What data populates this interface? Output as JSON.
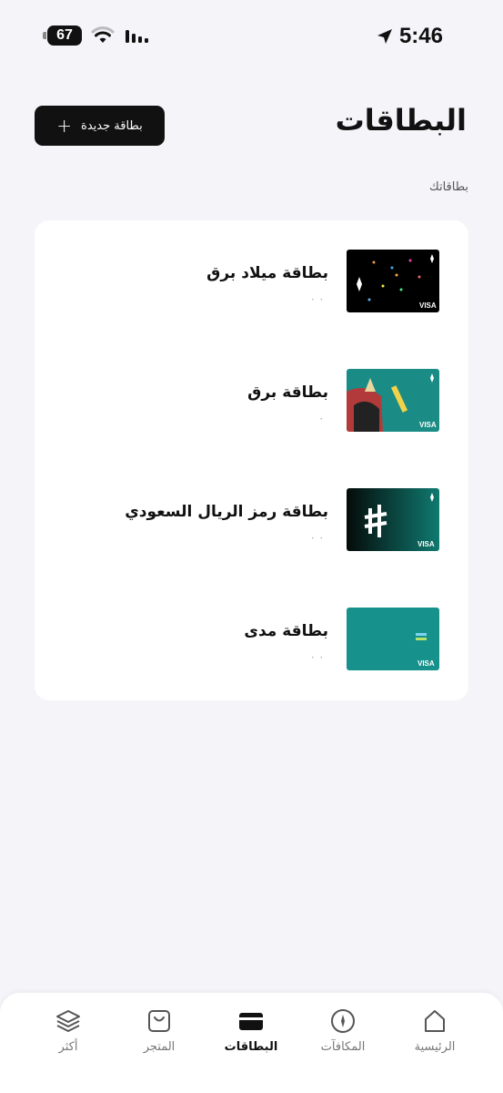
{
  "status": {
    "time": "5:46",
    "battery": "67"
  },
  "header": {
    "title": "البطاقات",
    "new_card_label": "بطاقة جديدة"
  },
  "section_label": "بطاقاتك",
  "cards": [
    {
      "name": "بطاقة ميلاد برق",
      "number": "• •",
      "thumb_color": "#000000",
      "thumb_brand": "VISA"
    },
    {
      "name": "بطاقة برق",
      "number": "•",
      "thumb_color": "#1a8c85",
      "thumb_brand": "VISA"
    },
    {
      "name": "بطاقة رمز الريال السعودي",
      "number": "• •",
      "thumb_color": "#0b2a26",
      "thumb_brand": "VISA"
    },
    {
      "name": "بطاقة مدى",
      "number": "• •",
      "thumb_color": "#16918b",
      "thumb_brand": "VISA"
    }
  ],
  "nav": [
    {
      "label": "الرئيسية"
    },
    {
      "label": "المكافآت"
    },
    {
      "label": "البطاقات"
    },
    {
      "label": "المتجر"
    },
    {
      "label": "أكثر"
    }
  ],
  "colors": {
    "background": "#f5f4f9",
    "accent": "#111111"
  }
}
